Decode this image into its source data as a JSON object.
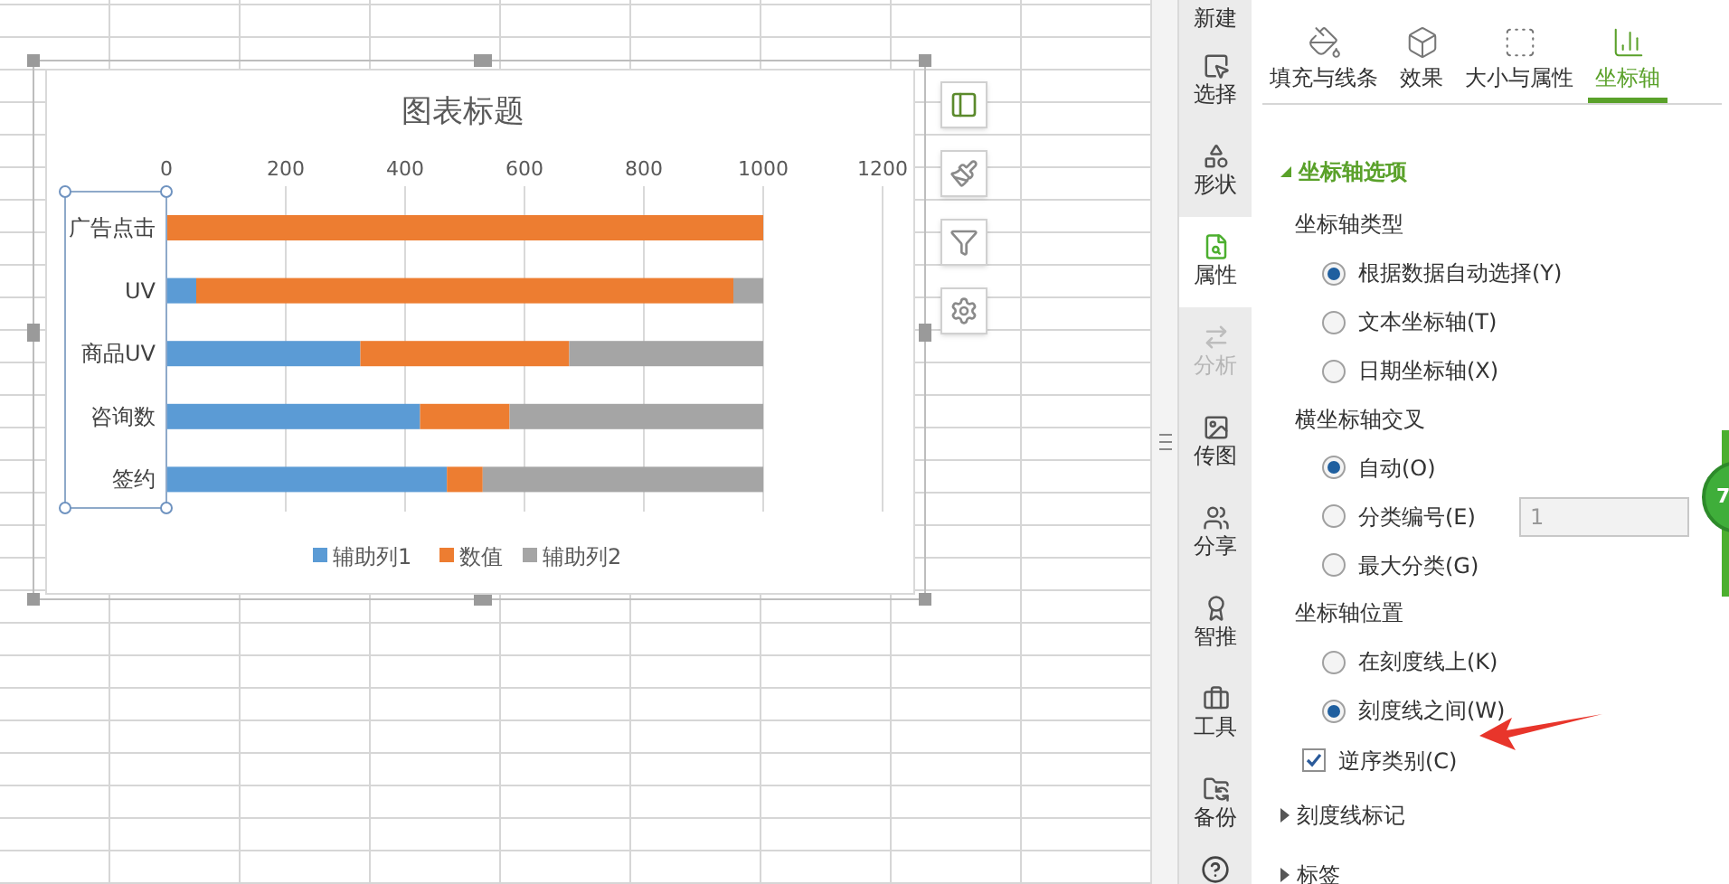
{
  "chart": {
    "chart_data": {
      "type": "bar",
      "orientation": "horizontal",
      "stacked": true,
      "title": "图表标题",
      "categories": [
        "广告点击",
        "UV",
        "商品UV",
        "咨询数",
        "签约"
      ],
      "xlim": [
        0,
        1200
      ],
      "grid": true,
      "legend": true,
      "xticks": [
        0,
        200,
        400,
        600,
        800,
        1000,
        1200
      ],
      "series": [
        {
          "name": "辅助列1",
          "color": "#5b9bd5",
          "values": [
            0,
            50,
            325,
            425,
            470
          ]
        },
        {
          "name": "数值",
          "color": "#ed7d31",
          "values": [
            1000,
            900,
            350,
            150,
            60
          ]
        },
        {
          "name": "辅助列2",
          "color": "#a5a5a5",
          "values": [
            0,
            50,
            325,
            425,
            470
          ]
        }
      ]
    }
  },
  "tools": [
    {
      "label": "新建",
      "selected": false,
      "disabled": false
    },
    {
      "label": "选择",
      "selected": false,
      "disabled": false
    },
    {
      "label": "形状",
      "selected": false,
      "disabled": false
    },
    {
      "label": "属性",
      "selected": true,
      "disabled": false
    },
    {
      "label": "分析",
      "selected": false,
      "disabled": true
    },
    {
      "label": "传图",
      "selected": false,
      "disabled": false
    },
    {
      "label": "分享",
      "selected": false,
      "disabled": false
    },
    {
      "label": "智推",
      "selected": false,
      "disabled": false
    },
    {
      "label": "工具",
      "selected": false,
      "disabled": false
    },
    {
      "label": "备份",
      "selected": false,
      "disabled": false
    }
  ],
  "panel": {
    "tabs": [
      {
        "label": "填充与线条",
        "selected": false
      },
      {
        "label": "效果",
        "selected": false
      },
      {
        "label": "大小与属性",
        "selected": false
      },
      {
        "label": "坐标轴",
        "selected": true
      }
    ],
    "sections": [
      {
        "title": "坐标轴选项",
        "expanded": true,
        "items": [
          {
            "kind": "heading",
            "text": "坐标轴类型"
          },
          {
            "kind": "radio",
            "label": "根据数据自动选择(Y)",
            "selected": true
          },
          {
            "kind": "radio",
            "label": "文本坐标轴(T)",
            "selected": false
          },
          {
            "kind": "radio",
            "label": "日期坐标轴(X)",
            "selected": false
          },
          {
            "kind": "heading",
            "text": "横坐标轴交叉"
          },
          {
            "kind": "radio",
            "label": "自动(O)",
            "selected": true
          },
          {
            "kind": "radio",
            "label": "分类编号(E)",
            "selected": false,
            "field": {
              "value": "1",
              "disabled": true
            }
          },
          {
            "kind": "radio",
            "label": "最大分类(G)",
            "selected": false
          },
          {
            "kind": "heading",
            "text": "坐标轴位置"
          },
          {
            "kind": "radio",
            "label": "在刻度线上(K)",
            "selected": false
          },
          {
            "kind": "radio",
            "label": "刻度线之间(W)",
            "selected": true
          },
          {
            "kind": "checkbox",
            "label": "逆序类别(C)",
            "checked": true
          }
        ]
      },
      {
        "title": "刻度线标记",
        "expanded": false
      },
      {
        "title": "标签",
        "expanded": false
      }
    ]
  },
  "badge": {
    "text": "7"
  }
}
